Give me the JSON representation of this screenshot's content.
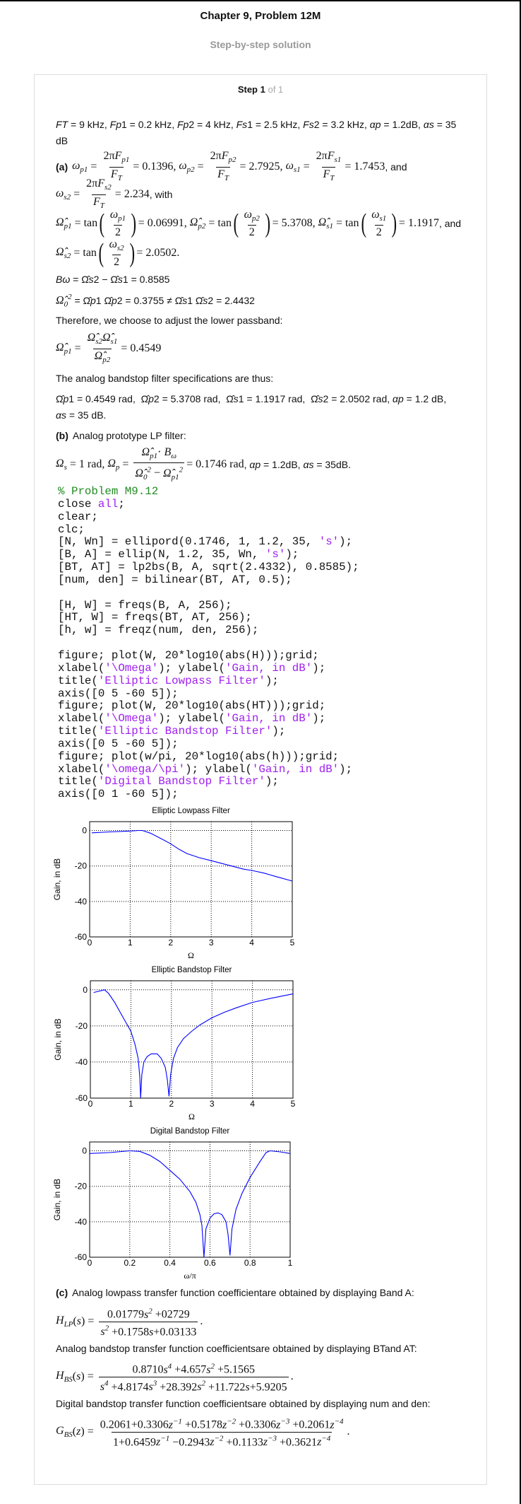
{
  "header": {
    "title": "Chapter 9, Problem 12M",
    "subtitle": "Step-by-step solution"
  },
  "step": {
    "label": "Step 1",
    "of": "of 1"
  },
  "lines": {
    "given": [
      {
        "pi": "FT"
      },
      {
        "p": " = 9 kHz, "
      },
      {
        "pi": "Fp"
      },
      {
        "p": "1 = 0.2 kHz, "
      },
      {
        "pi": "Fp"
      },
      {
        "p": "2 = 4 kHz, "
      },
      {
        "pi": "Fs"
      },
      {
        "p": "1 = 2.5 kHz, "
      },
      {
        "pi": "Fs"
      },
      {
        "p": "2 = 3.2 kHz, "
      },
      {
        "pi": "αp"
      },
      {
        "p": " = 1.2dB, "
      },
      {
        "pi": "αs"
      },
      {
        "p": " = 35"
      }
    ],
    "given2": [
      {
        "p": "dB"
      }
    ],
    "a1": [
      {
        "b": "(a)"
      },
      {
        "i": "ω",
        "sub": "p1"
      },
      " = ",
      {
        "num": [
          "2π",
          {
            "i": "F",
            "sub": "p1"
          }
        ],
        "den": [
          {
            "i": "F",
            "sub": "T"
          }
        ]
      },
      "= 0.1396, ",
      {
        "i": "ω",
        "sub": "p2"
      },
      " = ",
      {
        "num": [
          "2π",
          {
            "i": "F",
            "sub": "p2"
          }
        ],
        "den": [
          {
            "i": "F",
            "sub": "T"
          }
        ]
      },
      "= 2.7925, ",
      {
        "i": "ω",
        "sub": "s1"
      },
      " = ",
      {
        "num": [
          "2π",
          {
            "i": "F",
            "sub": "s1"
          }
        ],
        "den": [
          {
            "i": "F",
            "sub": "T"
          }
        ]
      },
      "= 1.7453",
      {
        "p": ", and"
      }
    ],
    "a2": [
      {
        "i": "ω",
        "sub": "s2"
      },
      " = ",
      {
        "num": [
          "2π",
          {
            "i": "F",
            "sub": "s2"
          }
        ],
        "den": [
          {
            "i": "F",
            "sub": "T"
          }
        ]
      },
      "= 2.234",
      {
        "p": ", with"
      }
    ],
    "a3": [
      {
        "i": "Ω̂",
        "sub": "p1"
      },
      " = tan",
      {
        "paren": true,
        "num": [
          {
            "i": "ω",
            "sub": "p1"
          }
        ],
        "den": [
          "2"
        ]
      },
      "= 0.06991, ",
      {
        "i": "Ω̂",
        "sub": "p2"
      },
      " = tan",
      {
        "paren": true,
        "num": [
          {
            "i": "ω",
            "sub": "p2"
          }
        ],
        "den": [
          "2"
        ]
      },
      "= 5.3708, ",
      {
        "i": "Ω̂",
        "sub": "s1"
      },
      " = tan",
      {
        "paren": true,
        "num": [
          {
            "i": "ω",
            "sub": "s1"
          }
        ],
        "den": [
          "2"
        ]
      },
      "= 1.1917",
      {
        "p": ", and"
      }
    ],
    "a4": [
      {
        "i": "Ω̂",
        "sub": "s2"
      },
      " = tan",
      {
        "paren": true,
        "num": [
          {
            "i": "ω",
            "sub": "s2"
          }
        ],
        "den": [
          "2"
        ]
      },
      "= 2.0502."
    ],
    "bw": [
      {
        "pi": "Bω"
      },
      {
        "p": " = Ω̂"
      },
      {
        "pi": "s"
      },
      {
        "p": "2 − Ω̂"
      },
      {
        "pi": "s"
      },
      {
        "p": "1 = 0.8585"
      }
    ],
    "omega0": [
      {
        "i": "Ω̂",
        "sub": "0",
        "sup": "2"
      },
      {
        "p": " = Ω̂"
      },
      {
        "pi": "p"
      },
      {
        "p": "1 Ω̂"
      },
      {
        "pi": "p"
      },
      {
        "p": "2 = 0.3755 ≠ Ω̂"
      },
      {
        "pi": "s"
      },
      {
        "p": "1 Ω̂"
      },
      {
        "pi": "s"
      },
      {
        "p": "2 = 2.4432"
      }
    ],
    "therefore": [
      {
        "p": "Therefore, we choose to adjust the lower passband:"
      }
    ],
    "adjust": [
      {
        "i": "Ω̂",
        "sub": "p1"
      },
      " = ",
      {
        "num": [
          {
            "i": "Ω̂",
            "sub": "s2"
          },
          {
            "i": "Ω̂",
            "sub": "s1"
          }
        ],
        "den": [
          {
            "i": "Ω̂",
            "sub": "p2"
          }
        ]
      },
      "= 0.4549"
    ],
    "spec_intro": [
      {
        "p": "The analog bandstop filter specifications are thus:"
      }
    ],
    "spec": [
      {
        "p": "Ω̂"
      },
      {
        "pi": "p"
      },
      {
        "p": "1 = 0.4549 rad,  Ω̂"
      },
      {
        "pi": "p"
      },
      {
        "p": "2 = 5.3708 rad,  Ω̂"
      },
      {
        "pi": "s"
      },
      {
        "p": "1 = 1.1917 rad,  Ω̂"
      },
      {
        "pi": "s"
      },
      {
        "p": "2 = 2.0502 rad, "
      },
      {
        "pi": "αp"
      },
      {
        "p": " = 1.2 dB,"
      }
    ],
    "spec2": [
      {
        "pi": "αs"
      },
      {
        "p": " = 35 dB."
      }
    ],
    "b_intro": [
      {
        "b": "(b)"
      },
      {
        "p": "Analog prototype LP filter:"
      }
    ],
    "b_eq": [
      {
        "i": "Ω",
        "sub": "s"
      },
      " = 1 rad, ",
      {
        "i": "Ω",
        "sub": "p"
      },
      " = ",
      {
        "num": [
          {
            "i": "Ω̂",
            "sub": "p1"
          },
          "· ",
          {
            "i": "B",
            "sub": "ω"
          }
        ],
        "den": [
          {
            "i": "Ω̂",
            "sub": "0",
            "sup": "2"
          },
          " − ",
          {
            "i": "Ω̂",
            "sub": "p1",
            "sup": "2"
          }
        ]
      },
      "= 0.1746 rad",
      {
        "p": ", "
      },
      {
        "pi": "αp"
      },
      {
        "p": " = 1.2dB, "
      },
      {
        "pi": "αs"
      },
      {
        "p": " = 35dB."
      }
    ],
    "c_intro": [
      {
        "b": "(c)"
      },
      {
        "p": "Analog lowpass transfer function coefficientare obtained by displaying Band A:"
      }
    ],
    "hlp": [
      {
        "i": "H",
        "sub": "LP"
      },
      "(",
      {
        "i": "s"
      },
      ") = ",
      {
        "num": [
          "0.01779",
          {
            "i": "s",
            "sup": "2"
          },
          " +02729"
        ],
        "den": [
          {
            "i": "s",
            "sup": "2"
          },
          " +0.1758",
          {
            "i": "s"
          },
          "+0.03133"
        ]
      },
      "."
    ],
    "bs_intro": [
      {
        "p": "Analog bandstop transfer function coefficientsare obtained by displaying BTand AT:"
      }
    ],
    "hbs": [
      {
        "i": "H",
        "sub": "BS"
      },
      "(",
      {
        "i": "s"
      },
      ") = ",
      {
        "num": [
          "0.8710",
          {
            "i": "s",
            "sup": "4"
          },
          " +4.657",
          {
            "i": "s",
            "sup": "2"
          },
          " +5.1565"
        ],
        "den": [
          {
            "i": "s",
            "sup": "4"
          },
          " +4.8174",
          {
            "i": "s",
            "sup": "3"
          },
          " +28.392",
          {
            "i": "s",
            "sup": "2"
          },
          " +11.722",
          {
            "i": "s"
          },
          "+5.9205"
        ]
      },
      "."
    ],
    "dig_intro": [
      {
        "p": "Digital bandstop transfer function coefficientsare obtained by displaying num and den:"
      }
    ],
    "gbs": [
      {
        "i": "G",
        "sub": "BS"
      },
      "(",
      {
        "i": "z"
      },
      ") = ",
      {
        "num": [
          "0.2061+0.3306",
          {
            "i": "z",
            "sup": "−1"
          },
          " +0.5178",
          {
            "i": "z",
            "sup": "−2"
          },
          " +0.3306",
          {
            "i": "z",
            "sup": "−3"
          },
          " +0.2061",
          {
            "i": "z",
            "sup": "−4"
          }
        ],
        "den": [
          "1+0.6459",
          {
            "i": "z",
            "sup": "−1"
          },
          " −0.2943",
          {
            "i": "z",
            "sup": "−2"
          },
          " +0.1133",
          {
            "i": "z",
            "sup": "−3"
          },
          " +0.3621",
          {
            "i": "z",
            "sup": "−4"
          }
        ]
      },
      "."
    ]
  },
  "code": {
    "colors": {
      "comment": "#228B22",
      "string": "#A020F0"
    },
    "lines": [
      [
        {
          "c": "% Problem M9.12"
        }
      ],
      [
        "close ",
        {
          "s": "all"
        },
        ";"
      ],
      [
        "clear;"
      ],
      [
        "clc;"
      ],
      [
        "[N, Wn] = ellipord(0.1746, 1, 1.2, 35, ",
        {
          "s": "'s'"
        },
        ");"
      ],
      [
        "[B, A] = ellip(N, 1.2, 35, Wn, ",
        {
          "s": "'s'"
        },
        ");"
      ],
      [
        "[BT, AT] = lp2bs(B, A, sqrt(2.4332), 0.8585);"
      ],
      [
        "[num, den] = bilinear(BT, AT, 0.5);"
      ],
      [
        ""
      ],
      [
        "[H, W] = freqs(B, A, 256);"
      ],
      [
        "[HT, W] = freqs(BT, AT, 256);"
      ],
      [
        "[h, w] = freqz(num, den, 256);"
      ],
      [
        ""
      ],
      [
        "figure; plot(W, 20*log10(abs(H)));grid;"
      ],
      [
        "xlabel(",
        {
          "s": "'\\Omega'"
        },
        "); ylabel(",
        {
          "s": "'Gain, in dB'"
        },
        ");"
      ],
      [
        "title(",
        {
          "s": "'Elliptic Lowpass Filter'"
        },
        ");"
      ],
      [
        "axis([0 5 -60 5]);"
      ],
      [
        "figure; plot(W, 20*log10(abs(HT)));grid;"
      ],
      [
        "xlabel(",
        {
          "s": "'\\Omega'"
        },
        "); ylabel(",
        {
          "s": "'Gain, in dB'"
        },
        ");"
      ],
      [
        "title(",
        {
          "s": "'Elliptic Bandstop Filter'"
        },
        ");"
      ],
      [
        "axis([0 5 -60 5]);"
      ],
      [
        "figure; plot(w/pi, 20*log10(abs(h)));grid;"
      ],
      [
        "xlabel(",
        {
          "s": "'\\omega/\\pi'"
        },
        "); ylabel(",
        {
          "s": "'Gain, in dB'"
        },
        ");"
      ],
      [
        "title(",
        {
          "s": "'Digital Bandstop Filter'"
        },
        ");"
      ],
      [
        "axis([0 1 -60 5]);"
      ]
    ]
  },
  "chart_data": [
    {
      "type": "line",
      "title": "Elliptic Lowpass Filter",
      "xlabel": "Ω",
      "ylabel": "Gain, in dB",
      "xlim": [
        0,
        5
      ],
      "ylim": [
        -60,
        5
      ],
      "grid": true,
      "line_color": "#0000FF",
      "xticks": [
        "0",
        "1",
        "2",
        "3",
        "4",
        "5"
      ],
      "yticks": [
        "0",
        "-20",
        "-40",
        "-60"
      ],
      "x": [
        0.05,
        0.5,
        1.0,
        1.2,
        1.3,
        1.5,
        1.8,
        2.0,
        2.2,
        2.4,
        2.7,
        3.0,
        3.5,
        3.8,
        4.0,
        4.3,
        4.6,
        5.0
      ],
      "y": [
        -1.3,
        -0.8,
        -0.3,
        0,
        0,
        -1.5,
        -5,
        -7.5,
        -10.5,
        -13,
        -15.3,
        -17,
        -20,
        -21.8,
        -22.5,
        -24,
        -26,
        -28.5
      ]
    },
    {
      "type": "line",
      "title": "Elliptic Bandstop Filter",
      "xlabel": "Ω",
      "ylabel": "Gain, in dB",
      "xlim": [
        0,
        5
      ],
      "ylim": [
        -60,
        5
      ],
      "grid": true,
      "line_color": "#0000FF",
      "xticks": [
        "0",
        "1",
        "2",
        "3",
        "4",
        "5"
      ],
      "yticks": [
        "0",
        "-20",
        "-40",
        "-60"
      ],
      "x": [
        0.08,
        0.35,
        0.45,
        0.6,
        0.8,
        1.0,
        1.1,
        1.18,
        1.22,
        1.24,
        1.27,
        1.32,
        1.4,
        1.5,
        1.65,
        1.75,
        1.85,
        1.9,
        1.94,
        1.98,
        2.05,
        2.15,
        2.3,
        2.5,
        2.7,
        3.0,
        3.3,
        3.6,
        4.0,
        4.5,
        5.0
      ],
      "y": [
        -1.5,
        0,
        -2,
        -7,
        -15,
        -23,
        -30,
        -38,
        -48,
        -60,
        -47,
        -40,
        -37,
        -35.5,
        -35.5,
        -38,
        -43,
        -50,
        -59,
        -47,
        -38,
        -32,
        -27,
        -23,
        -19.5,
        -15.5,
        -12.5,
        -10,
        -7,
        -4.5,
        -2.3
      ]
    },
    {
      "type": "line",
      "title": "Digital Bandstop Filter",
      "xlabel": "ω/π",
      "ylabel": "Gain, in dB",
      "xlim": [
        0,
        1
      ],
      "ylim": [
        -60,
        5
      ],
      "grid": true,
      "line_color": "#0000FF",
      "xticks": [
        "0",
        "0.2",
        "0.4",
        "0.6",
        "0.8",
        "1"
      ],
      "yticks": [
        "0",
        "-20",
        "-40",
        "-60"
      ],
      "x": [
        0,
        0.1,
        0.2,
        0.25,
        0.3,
        0.35,
        0.4,
        0.45,
        0.5,
        0.53,
        0.55,
        0.56,
        0.57,
        0.58,
        0.6,
        0.62,
        0.64,
        0.66,
        0.68,
        0.69,
        0.7,
        0.71,
        0.73,
        0.76,
        0.8,
        0.85,
        0.88,
        0.9,
        0.95,
        1.0
      ],
      "y": [
        -1.5,
        -1,
        0,
        -0.3,
        -2.5,
        -6,
        -11,
        -16,
        -23,
        -29,
        -36,
        -42,
        -60,
        -44,
        -38,
        -35.5,
        -35,
        -36,
        -40,
        -47,
        -59,
        -44,
        -33,
        -24,
        -15,
        -6,
        -1,
        0,
        -0.6,
        -1.5
      ]
    }
  ]
}
